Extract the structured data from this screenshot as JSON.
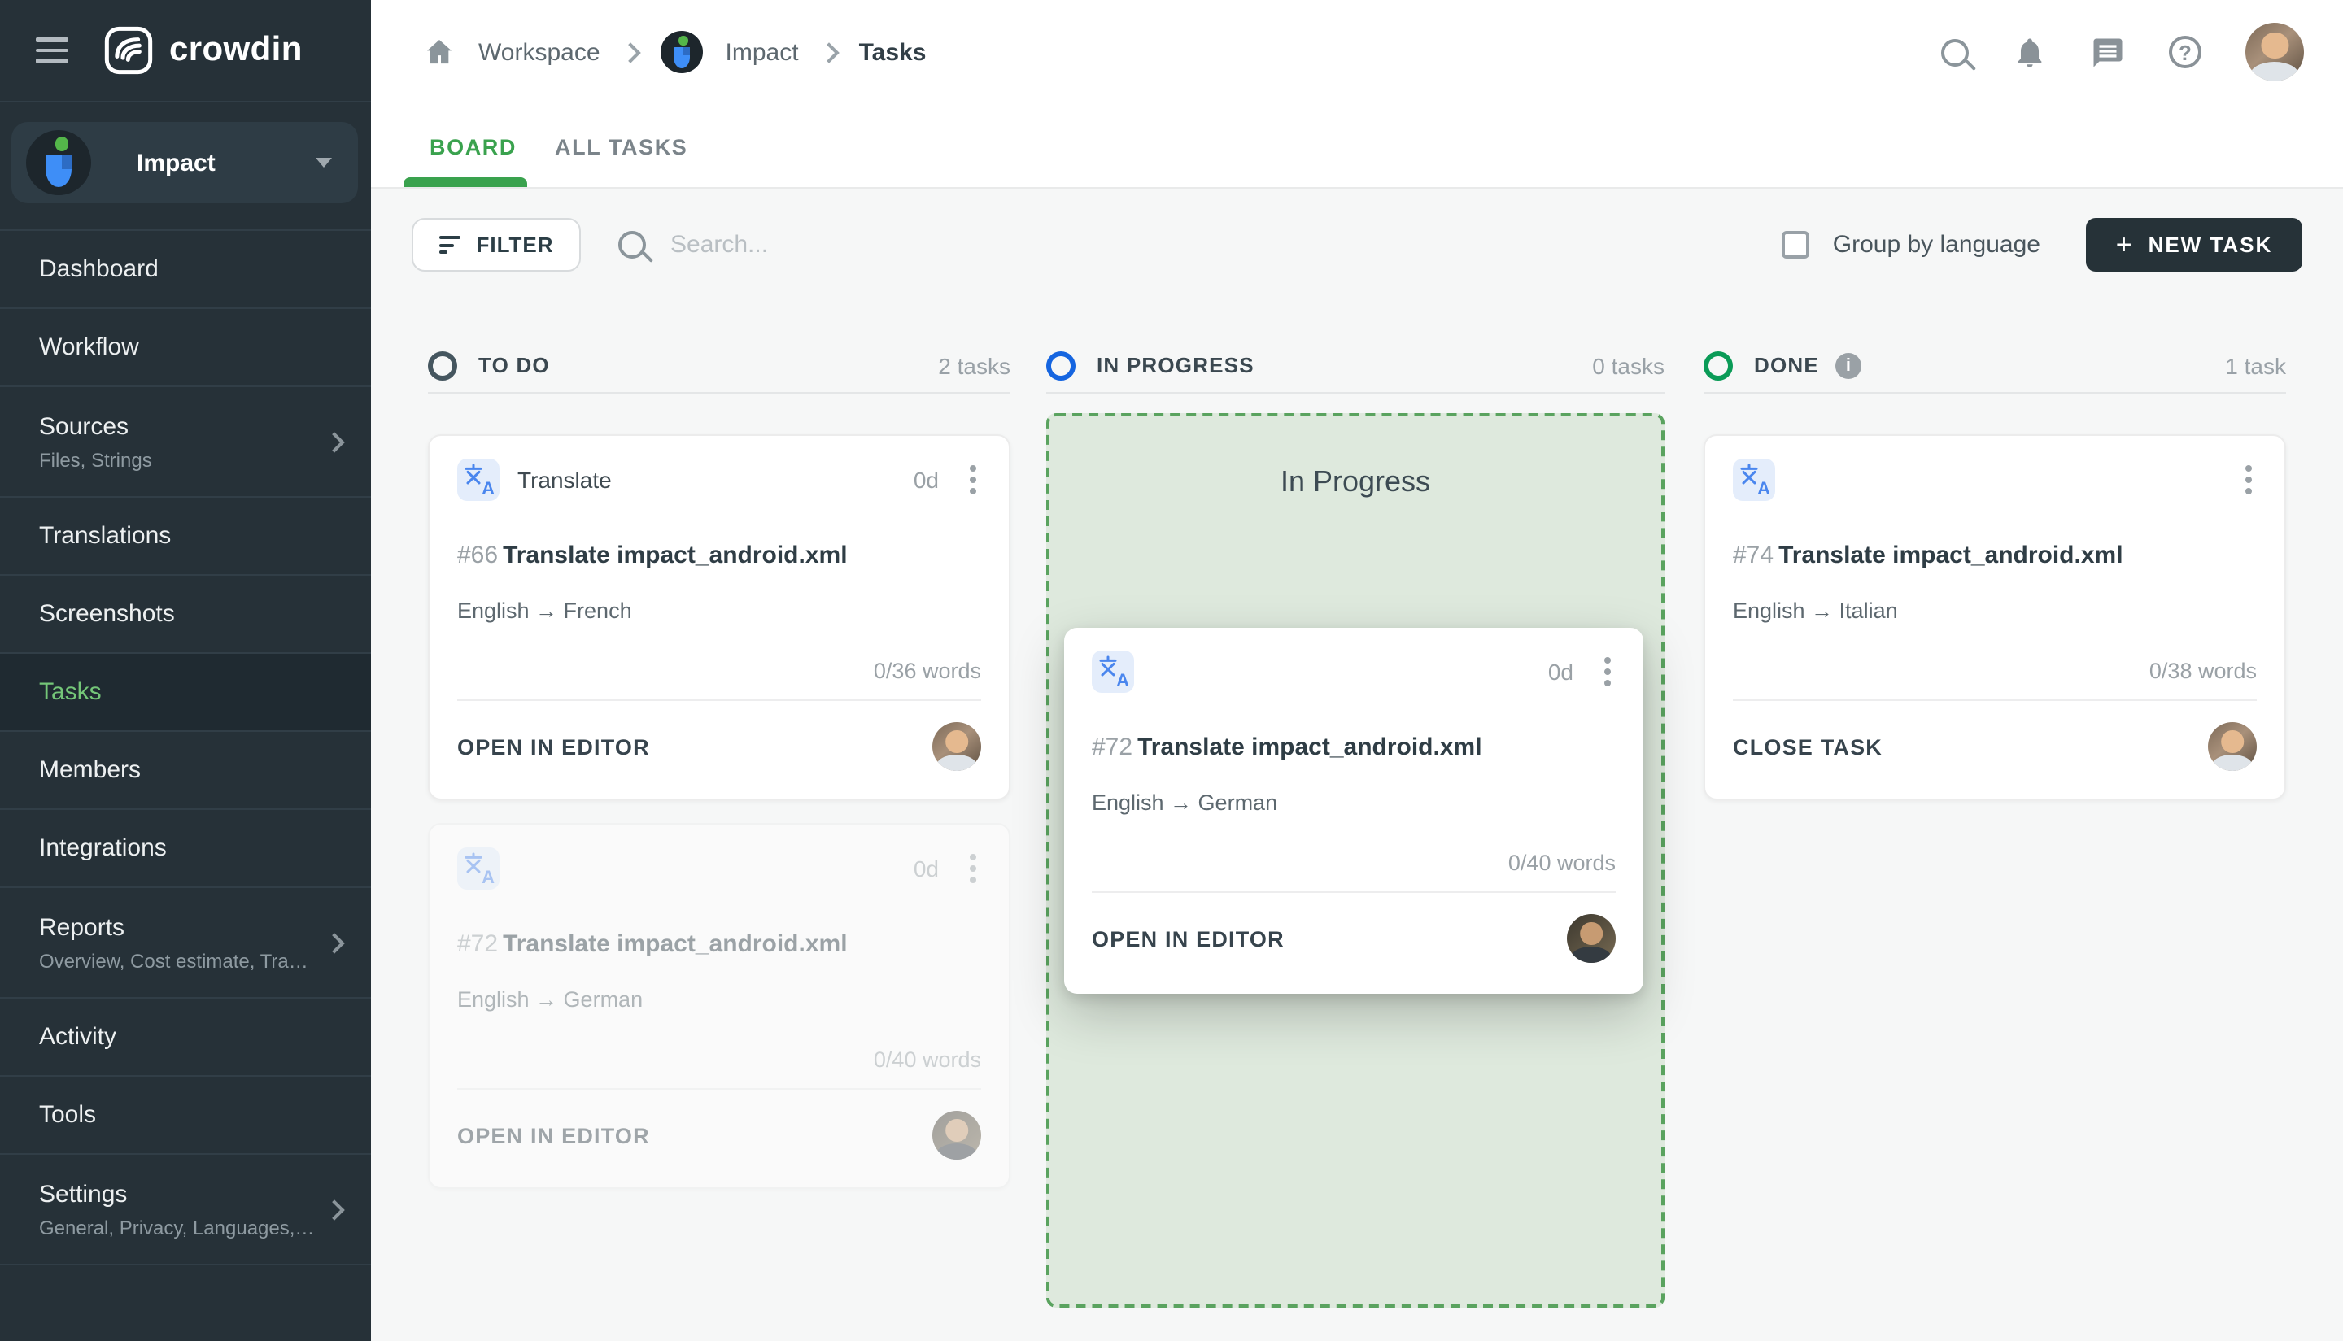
{
  "brand": {
    "name": "crowdin"
  },
  "sidebar": {
    "project": {
      "name": "Impact"
    },
    "items": [
      {
        "label": "Dashboard"
      },
      {
        "label": "Workflow"
      },
      {
        "label": "Sources",
        "subtitle": "Files, Strings"
      },
      {
        "label": "Translations"
      },
      {
        "label": "Screenshots"
      },
      {
        "label": "Tasks"
      },
      {
        "label": "Members"
      },
      {
        "label": "Integrations"
      },
      {
        "label": "Reports",
        "subtitle": "Overview, Cost estimate, Transl..."
      },
      {
        "label": "Activity"
      },
      {
        "label": "Tools"
      },
      {
        "label": "Settings",
        "subtitle": "General, Privacy, Languages, Q..."
      }
    ]
  },
  "breadcrumb": {
    "items": [
      "Workspace",
      "Impact",
      "Tasks"
    ]
  },
  "tabs": [
    {
      "label": "BOARD"
    },
    {
      "label": "ALL TASKS"
    }
  ],
  "toolbar": {
    "filter_label": "FILTER",
    "search_placeholder": "Search...",
    "group_by_language_label": "Group by language",
    "new_task_label": "NEW TASK",
    "new_task_plus": "+"
  },
  "board": {
    "columns": {
      "todo": {
        "name": "TO DO",
        "count": "2 tasks",
        "ring_color": "#45565f"
      },
      "in_progress": {
        "name": "IN PROGRESS",
        "count": "0 tasks",
        "ring_color": "#1565e0"
      },
      "done": {
        "name": "DONE",
        "count": "1 task",
        "ring_color": "#0a9b57",
        "info": "i"
      }
    },
    "drop_zone_label": "In Progress",
    "cards": {
      "todo": {
        "type_label": "Translate",
        "duration": "0d",
        "id": "#66",
        "title": "Translate impact_android.xml",
        "languages": "English → French",
        "words": "0/36 words",
        "action": "OPEN IN EDITOR"
      },
      "todo_ghost": {
        "duration": "0d",
        "id": "#72",
        "title": "Translate impact_android.xml",
        "languages": "English → German",
        "words": "0/40 words",
        "action": "OPEN IN EDITOR"
      },
      "dragging": {
        "duration": "0d",
        "id": "#72",
        "title": "Translate impact_android.xml",
        "languages": "English → German",
        "words": "0/40 words",
        "action": "OPEN IN EDITOR"
      },
      "done": {
        "id": "#74",
        "title": "Translate impact_android.xml",
        "languages": "English → Italian",
        "words": "0/38 words",
        "action": "CLOSE TASK"
      }
    }
  },
  "colors": {
    "accent_green": "#3aa24e",
    "sidebar_active_green": "#74c678",
    "brand_dark": "#263238",
    "drop_zone_bg": "#dee9dd",
    "drop_zone_border": "#5aa35f"
  }
}
